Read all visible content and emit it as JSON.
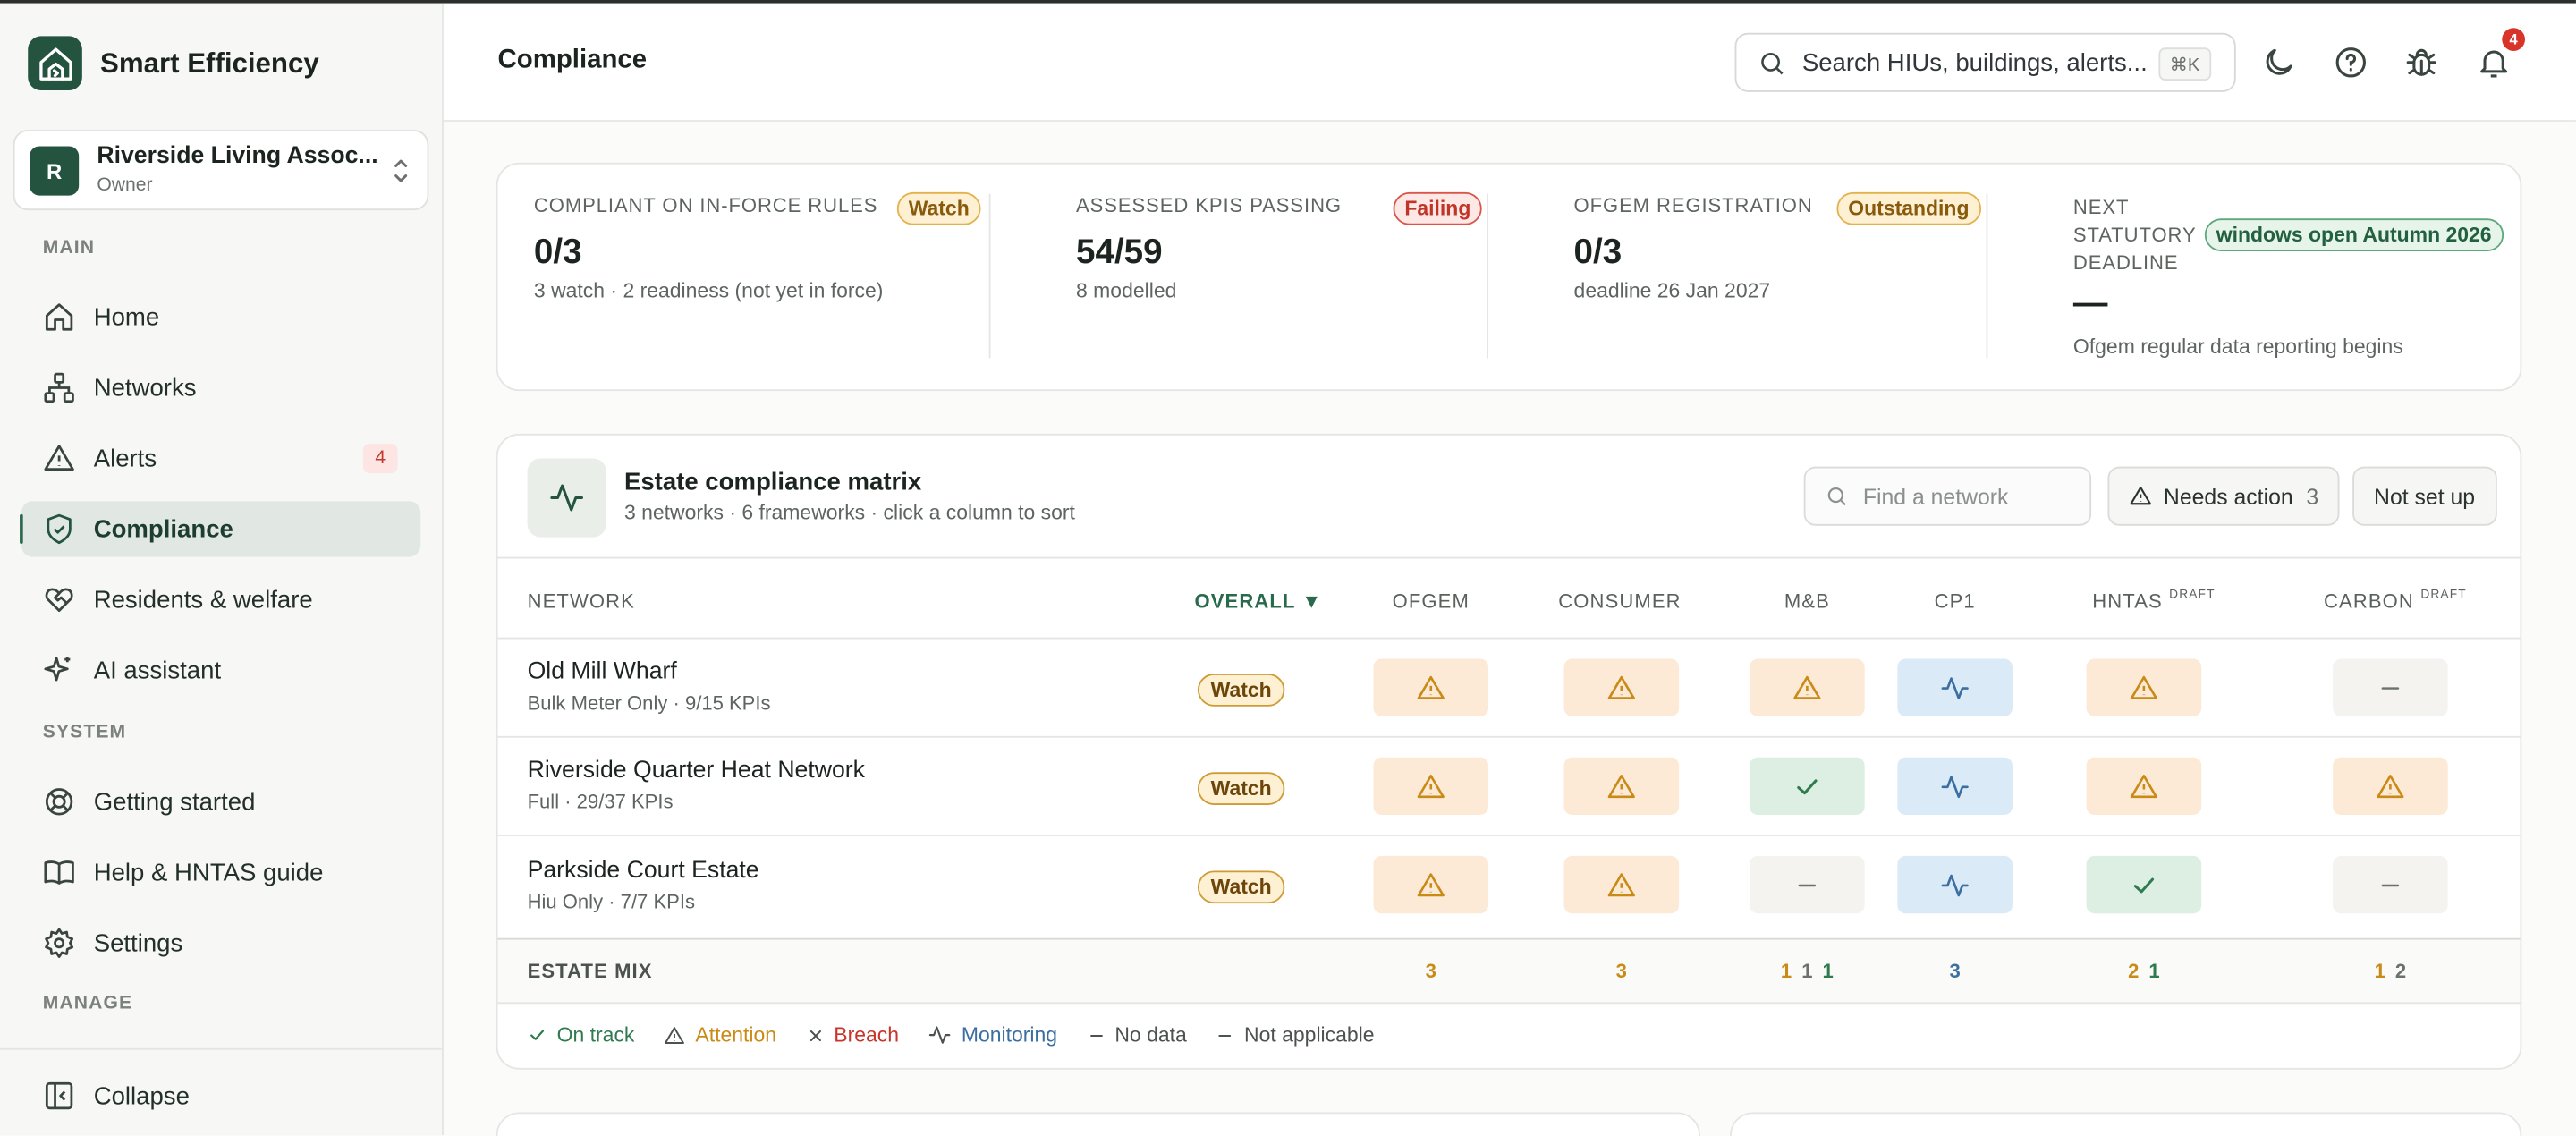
{
  "app": {
    "name": "Smart Efficiency"
  },
  "org": {
    "name": "Riverside Living Assoc...",
    "role": "Owner",
    "initial": "R"
  },
  "sidebar": {
    "main_label": "MAIN",
    "system_label": "SYSTEM",
    "manage_label": "MANAGE",
    "items": [
      {
        "label": "Home",
        "icon": "home-icon"
      },
      {
        "label": "Networks",
        "icon": "network-icon"
      },
      {
        "label": "Alerts",
        "icon": "alert-triangle-icon",
        "badge": "4"
      },
      {
        "label": "Compliance",
        "icon": "shield-check-icon",
        "active": true
      },
      {
        "label": "Residents & welfare",
        "icon": "heart-handshake-icon"
      },
      {
        "label": "AI assistant",
        "icon": "sparkles-icon"
      },
      {
        "label": "Getting started",
        "icon": "lifebuoy-icon"
      },
      {
        "label": "Help & HNTAS guide",
        "icon": "book-icon"
      },
      {
        "label": "Settings",
        "icon": "gear-icon"
      }
    ],
    "collapse_label": "Collapse"
  },
  "header": {
    "title": "Compliance",
    "search_placeholder": "Search HIUs, buildings, alerts...",
    "search_shortcut": "⌘K",
    "notifications_count": "4"
  },
  "kpis": [
    {
      "label": "COMPLIANT ON IN-FORCE RULES",
      "value": "0/3",
      "sub": "3 watch · 2 readiness (not yet in force)",
      "pill": "Watch",
      "pill_kind": "watch"
    },
    {
      "label": "ASSESSED KPIS PASSING",
      "value": "54/59",
      "sub": "8 modelled",
      "pill": "Failing",
      "pill_kind": "fail"
    },
    {
      "label": "OFGEM REGISTRATION",
      "value": "0/3",
      "sub": "deadline 26 Jan 2027",
      "pill": "Outstanding",
      "pill_kind": "watch"
    },
    {
      "label_lines": [
        "NEXT",
        "STATUTORY",
        "DEADLINE"
      ],
      "value": "—",
      "sub": "Ofgem regular data reporting begins",
      "pill": "windows open Autumn 2026",
      "pill_kind": "ok"
    }
  ],
  "matrix": {
    "title": "Estate compliance matrix",
    "subtitle": "3 networks · 6 frameworks · click a column to sort",
    "search_placeholder": "Find a network",
    "needs_action_label": "Needs action",
    "needs_action_count": "3",
    "not_set_up_label": "Not set up",
    "columns": [
      {
        "label": "NETWORK"
      },
      {
        "label": "OVERALL ▼"
      },
      {
        "label": "OFGEM"
      },
      {
        "label": "CONSUMER"
      },
      {
        "label": "M&B"
      },
      {
        "label": "CP1"
      },
      {
        "label": "HNTAS",
        "tag": "DRAFT"
      },
      {
        "label": "CARBON",
        "tag": "DRAFT"
      }
    ],
    "rows": [
      {
        "name": "Old Mill Wharf",
        "sub": "Bulk Meter Only · 9/15 KPIs",
        "overall": "Watch",
        "cells": [
          "attention",
          "attention",
          "attention",
          "monitoring",
          "attention",
          "not-applicable"
        ]
      },
      {
        "name": "Riverside Quarter Heat Network",
        "sub": "Full · 29/37 KPIs",
        "overall": "Watch",
        "cells": [
          "attention",
          "attention",
          "on-track",
          "monitoring",
          "attention",
          "attention"
        ]
      },
      {
        "name": "Parkside Court Estate",
        "sub": "Hiu Only · 7/7 KPIs",
        "overall": "Watch",
        "cells": [
          "attention",
          "attention",
          "not-applicable",
          "monitoring",
          "on-track",
          "not-applicable"
        ]
      }
    ],
    "estate_mix_label": "ESTATE MIX",
    "estate_mix": [
      [
        {
          "v": "3",
          "kind": "attention"
        }
      ],
      [
        {
          "v": "3",
          "kind": "attention"
        }
      ],
      [
        {
          "v": "1",
          "kind": "attention"
        },
        {
          "v": "1",
          "kind": "neutral"
        },
        {
          "v": "1",
          "kind": "ok"
        }
      ],
      [
        {
          "v": "3",
          "kind": "monitoring"
        }
      ],
      [
        {
          "v": "2",
          "kind": "attention"
        },
        {
          "v": "1",
          "kind": "ok"
        }
      ],
      [
        {
          "v": "1",
          "kind": "attention"
        },
        {
          "v": "2",
          "kind": "neutral"
        }
      ]
    ],
    "legend": [
      {
        "label": "On track",
        "kind": "on-track"
      },
      {
        "label": "Attention",
        "kind": "attention"
      },
      {
        "label": "Breach",
        "kind": "breach"
      },
      {
        "label": "Monitoring",
        "kind": "monitoring"
      },
      {
        "label": "No data",
        "kind": "no-data"
      },
      {
        "label": "Not applicable",
        "kind": "not-applicable"
      }
    ]
  },
  "colors": {
    "brand": "#24543f",
    "attention": "#c98a16",
    "on_track": "#2f7a4f",
    "breach": "#c9342a",
    "monitoring": "#3a6f9f",
    "neutral": "#6b716d"
  }
}
